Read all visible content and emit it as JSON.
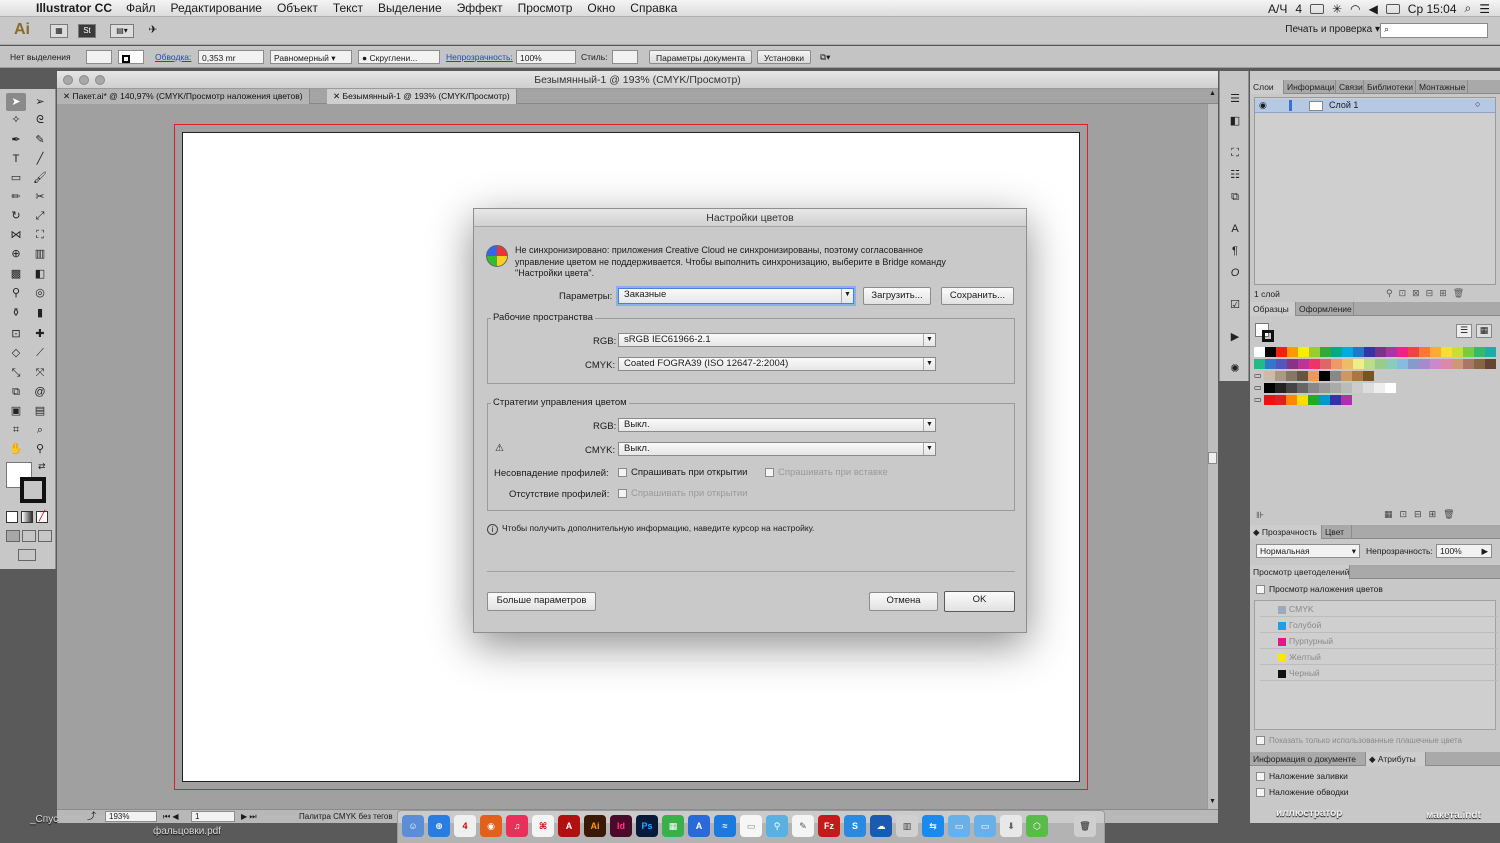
{
  "menubar": {
    "app": "Illustrator CC",
    "items": [
      "Файл",
      "Редактирование",
      "Объект",
      "Текст",
      "Выделение",
      "Эффект",
      "Просмотр",
      "Окно",
      "Справка"
    ],
    "right": {
      "lang": "А/Ч",
      "battery": "4",
      "clock": "Ср 15:04"
    }
  },
  "appbar": {
    "logo": "Ai",
    "badge": "St",
    "workspace": "Печать и проверка ▾"
  },
  "control": {
    "no_selection": "Нет выделения",
    "stroke_label": "Обводка:",
    "stroke_value": "0,353 mr",
    "profile": "Равномерный",
    "brush": "Скруглени...",
    "opacity_label": "Непрозрачность:",
    "opacity_value": "100%",
    "style_label": "Стиль:",
    "doc_settings": "Параметры документа",
    "prefs": "Установки"
  },
  "document": {
    "window_title": "Безымянный-1 @ 193% (CMYK/Просмотр)",
    "tabs": [
      "Пакет.ai* @ 140,97% (CMYK/Просмотр наложения цветов)",
      "Безымянный-1 @ 193% (CMYK/Просмотр)"
    ],
    "zoom": "193%",
    "page": "1",
    "status_text": "Палитра CMYK без тегов"
  },
  "dialog": {
    "title": "Настройки цветов",
    "warning": [
      "Не синхронизировано: приложения Creative Cloud не синхронизированы, поэтому согласованное",
      "управление цветом не поддерживается. Чтобы выполнить синхронизацию, выберите в Bridge команду",
      "\"Настройки цвета\"."
    ],
    "settings_label": "Параметры:",
    "settings_value": "Заказные",
    "load": "Загрузить...",
    "save": "Сохранить...",
    "workspaces_title": "Рабочие пространства",
    "rgb_label": "RGB:",
    "rgb_value": "sRGB IEC61966-2.1",
    "cmyk_label": "CMYK:",
    "cmyk_value": "Coated FOGRA39 (ISO 12647-2:2004)",
    "policies_title": "Стратегии управления цветом",
    "policy_rgb_label": "RGB:",
    "policy_rgb_value": "Выкл.",
    "policy_cmyk_label": "CMYK:",
    "policy_cmyk_value": "Выкл.",
    "mismatch_label": "Несовпадение профилей:",
    "ask_open": "Спрашивать при открытии",
    "ask_paste": "Спрашивать при вставке",
    "missing_label": "Отсутствие профилей:",
    "ask_open2": "Спрашивать при открытии",
    "info": "Чтобы получить дополнительную информацию, наведите курсор на настройку.",
    "more": "Больше параметров",
    "cancel": "Отмена",
    "ok": "OK"
  },
  "panels": {
    "layers_tabs": [
      "Слои",
      "Информаци",
      "Связи",
      "Библиотеки",
      "Монтажные"
    ],
    "layer_name": "Слой 1",
    "layers_count": "1 слой",
    "swatches_tabs": [
      "Образцы",
      "Оформление"
    ],
    "transparency_tabs": [
      "Прозрачность",
      "Цвет"
    ],
    "blend_mode": "Нормальная",
    "opacity_label": "Непрозрачность:",
    "opacity_value": "100%",
    "separations_title": "Просмотр цветоделений",
    "overprint_preview": "Просмотр наложения цветов",
    "separations": [
      "CMYK",
      "Голубой",
      "Пурпурный",
      "Желтый",
      "Черный"
    ],
    "show_used": "Показать только использованные плашечные цвета",
    "docinfo_tabs": [
      "Информация о документе",
      "Атрибуты"
    ],
    "fill_overprint": "Наложение заливки",
    "stroke_overprint": "Наложение обводки"
  },
  "desktop": {
    "item1": "иллюстратор",
    "item2": "макета.indt",
    "item3": "фальцовки.pdf",
    "item4": "_Спус"
  },
  "colors": {
    "accent": "#1a4fb0",
    "bleed": "#d2242c",
    "selection": "#b5c9e4"
  }
}
